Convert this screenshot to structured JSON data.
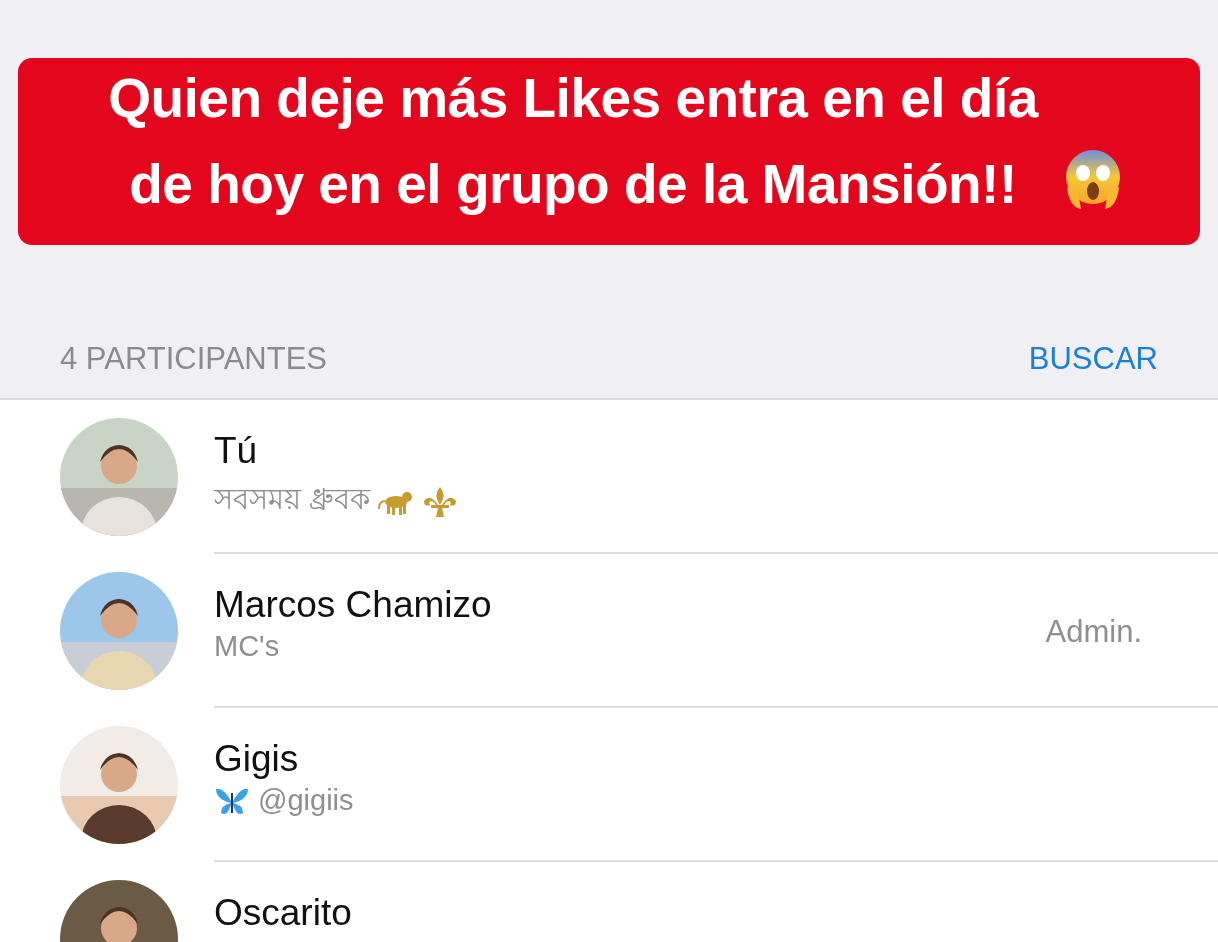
{
  "caption": {
    "text": "Quien deje más Likes entra en el día de hoy en el grupo de la Mansión!!"
  },
  "participants_header": {
    "count_label": "4 PARTICIPANTES",
    "search_link": "BUSCAR"
  },
  "participants": [
    {
      "name": "Tú",
      "status": "সবসময় ধ্রুবক"
    },
    {
      "name": "Marcos Chamizo",
      "status": "MC's",
      "role": "Admin."
    },
    {
      "name": "Gigis",
      "status": "@gigiis"
    },
    {
      "name": "Oscarito"
    }
  ]
}
